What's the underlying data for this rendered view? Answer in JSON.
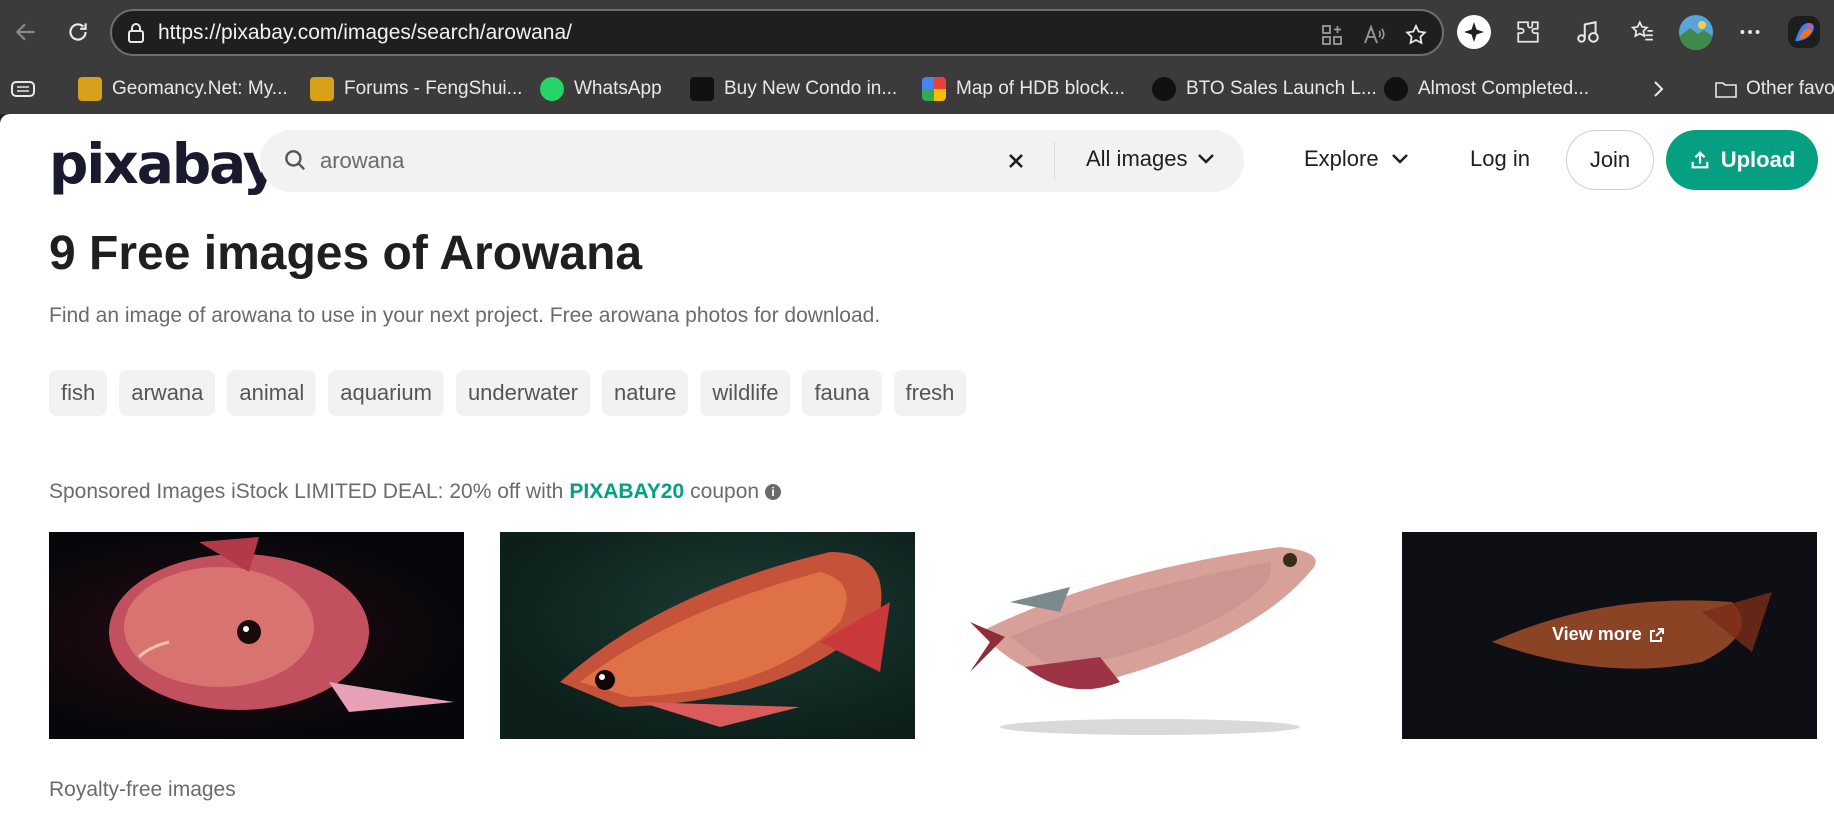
{
  "browser": {
    "url": "https://pixabay.com/images/search/arowana/",
    "bookmarks": [
      {
        "label": "Geomancy.Net: My...",
        "color": "#d9a11a"
      },
      {
        "label": "Forums - FengShui...",
        "color": "#d9a11a"
      },
      {
        "label": "WhatsApp",
        "color": "#25d366"
      },
      {
        "label": "Buy New Condo in...",
        "color": "#111111"
      },
      {
        "label": "Map of HDB block...",
        "color": "#4f8ef7"
      },
      {
        "label": "BTO Sales Launch L...",
        "color": "#111111"
      },
      {
        "label": "Almost Completed...",
        "color": "#111111"
      }
    ],
    "other_favorites": "Other favo"
  },
  "header": {
    "logo": "pixabay",
    "search_value": "arowana",
    "filter_label": "All images",
    "explore_label": "Explore",
    "login_label": "Log in",
    "join_label": "Join",
    "upload_label": "Upload"
  },
  "main": {
    "title": "9 Free images of Arowana",
    "subtitle": "Find an image of arowana to use in your next project. Free arowana photos for download.",
    "tags": [
      "fish",
      "arwana",
      "animal",
      "aquarium",
      "underwater",
      "nature",
      "wildlife",
      "fauna",
      "fresh"
    ],
    "sponsored_prefix": "Sponsored Images iStock LIMITED DEAL: 20% off with",
    "sponsored_code": "PIXABAY20",
    "sponsored_suffix": "coupon",
    "info_glyph": "i",
    "view_more": "View more",
    "royalty_label": "Royalty-free images"
  },
  "colors": {
    "accent": "#05a081"
  }
}
